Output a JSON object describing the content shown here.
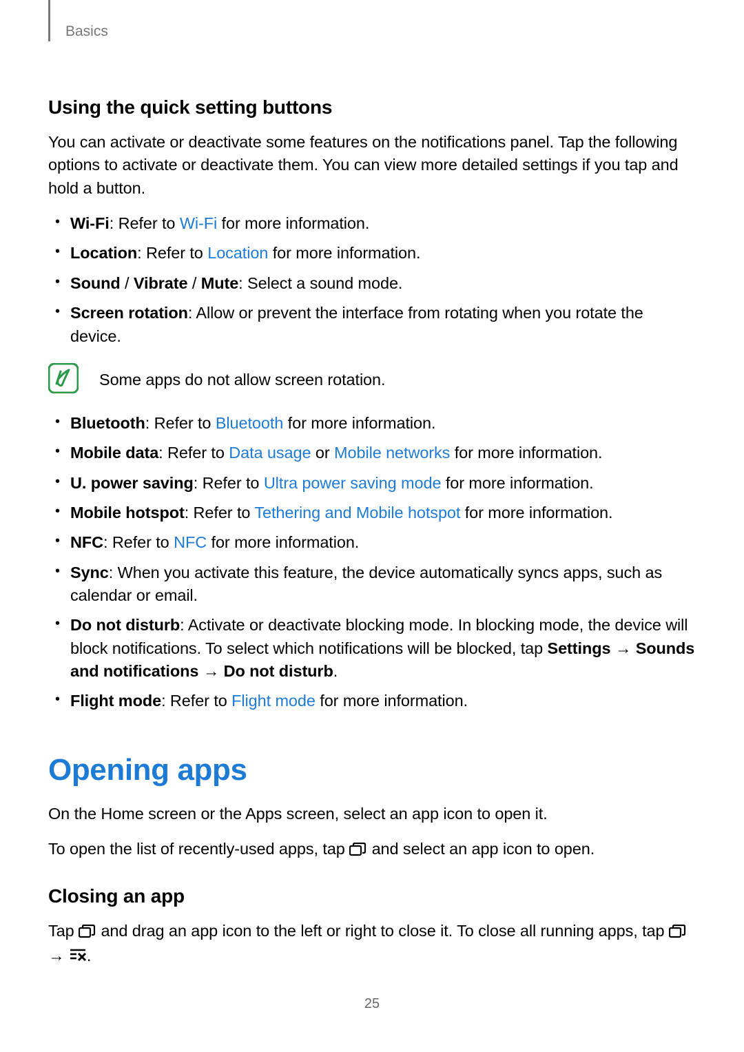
{
  "breadcrumb": "Basics",
  "heading_quick": "Using the quick setting buttons",
  "intro_quick": "You can activate or deactivate some features on the notifications panel. Tap the following options to activate or deactivate them. You can view more detailed settings if you tap and hold a button.",
  "wifi_label": "Wi-Fi",
  "wifi_pre": ": Refer to ",
  "wifi_link": "Wi-Fi",
  "wifi_post": " for more information.",
  "location_label": "Location",
  "location_pre": ": Refer to ",
  "location_link": "Location",
  "location_post": " for more information.",
  "sound_label": "Sound",
  "sound_sep1": " / ",
  "vibrate_label": "Vibrate",
  "sound_sep2": " / ",
  "mute_label": "Mute",
  "sound_desc": ": Select a sound mode.",
  "rotation_label": "Screen rotation",
  "rotation_desc": ": Allow or prevent the interface from rotating when you rotate the device.",
  "note_rotation": "Some apps do not allow screen rotation.",
  "bt_label": "Bluetooth",
  "bt_pre": ": Refer to ",
  "bt_link": "Bluetooth",
  "bt_post": " for more information.",
  "md_label": "Mobile data",
  "md_pre": ": Refer to ",
  "md_link1": "Data usage",
  "md_or": " or ",
  "md_link2": "Mobile networks",
  "md_post": " for more information.",
  "ups_label": "U. power saving",
  "ups_pre": ": Refer to ",
  "ups_link": "Ultra power saving mode",
  "ups_post": " for more information.",
  "mh_label": "Mobile hotspot",
  "mh_pre": ": Refer to ",
  "mh_link": "Tethering and Mobile hotspot",
  "mh_post": " for more information.",
  "nfc_label": "NFC",
  "nfc_pre": ": Refer to ",
  "nfc_link": "NFC",
  "nfc_post": " for more information.",
  "sync_label": "Sync",
  "sync_desc": ": When you activate this feature, the device automatically syncs apps, such as calendar or email.",
  "dnd_label": "Do not disturb",
  "dnd_pre": ": Activate or deactivate blocking mode. In blocking mode, the device will block notifications. To select which notifications will be blocked, tap ",
  "dnd_settings": "Settings",
  "dnd_arrow1": " → ",
  "dnd_sounds": "Sounds and notifications",
  "dnd_arrow2": " → ",
  "dnd_dnd": "Do not disturb",
  "dnd_period": ".",
  "fm_label": "Flight mode",
  "fm_pre": ": Refer to ",
  "fm_link": "Flight mode",
  "fm_post": " for more information.",
  "heading_opening": "Opening apps",
  "opening_p1": "On the Home screen or the Apps screen, select an app icon to open it.",
  "opening_p2a": "To open the list of recently-used apps, tap ",
  "opening_p2b": " and select an app icon to open.",
  "heading_closing": "Closing an app",
  "closing_p1a": "Tap ",
  "closing_p1b": " and drag an app icon to the left or right to close it. To close all running apps, tap ",
  "closing_arrow": " → ",
  "closing_period": ".",
  "page_number": "25"
}
